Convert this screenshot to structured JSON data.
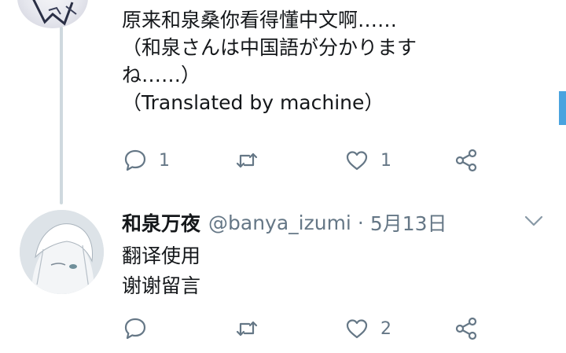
{
  "tweet1": {
    "lines": [
      "原来和泉桑你看得懂中文啊……",
      "（和泉さんは中国語が分かります",
      "ね……）",
      "（Translated by machine）"
    ],
    "actions": {
      "reply_count": "1",
      "retweet_count": "",
      "like_count": "1"
    }
  },
  "tweet2": {
    "display_name": "和泉万夜",
    "handle": "@banya_izumi",
    "separator": "·",
    "date": "5月13日",
    "lines": [
      "翻译使用",
      "谢谢留言"
    ],
    "actions": {
      "reply_count": "",
      "retweet_count": "",
      "like_count": "2"
    }
  },
  "icons": {
    "reply": "reply-icon",
    "retweet": "retweet-icon",
    "like": "heart-icon",
    "share": "share-icon",
    "more": "chevron-down-icon"
  },
  "colors": {
    "text": "#14171a",
    "secondary": "#657786",
    "thread_line": "#cfd9de",
    "scroll_indicator": "#4aa3df"
  }
}
